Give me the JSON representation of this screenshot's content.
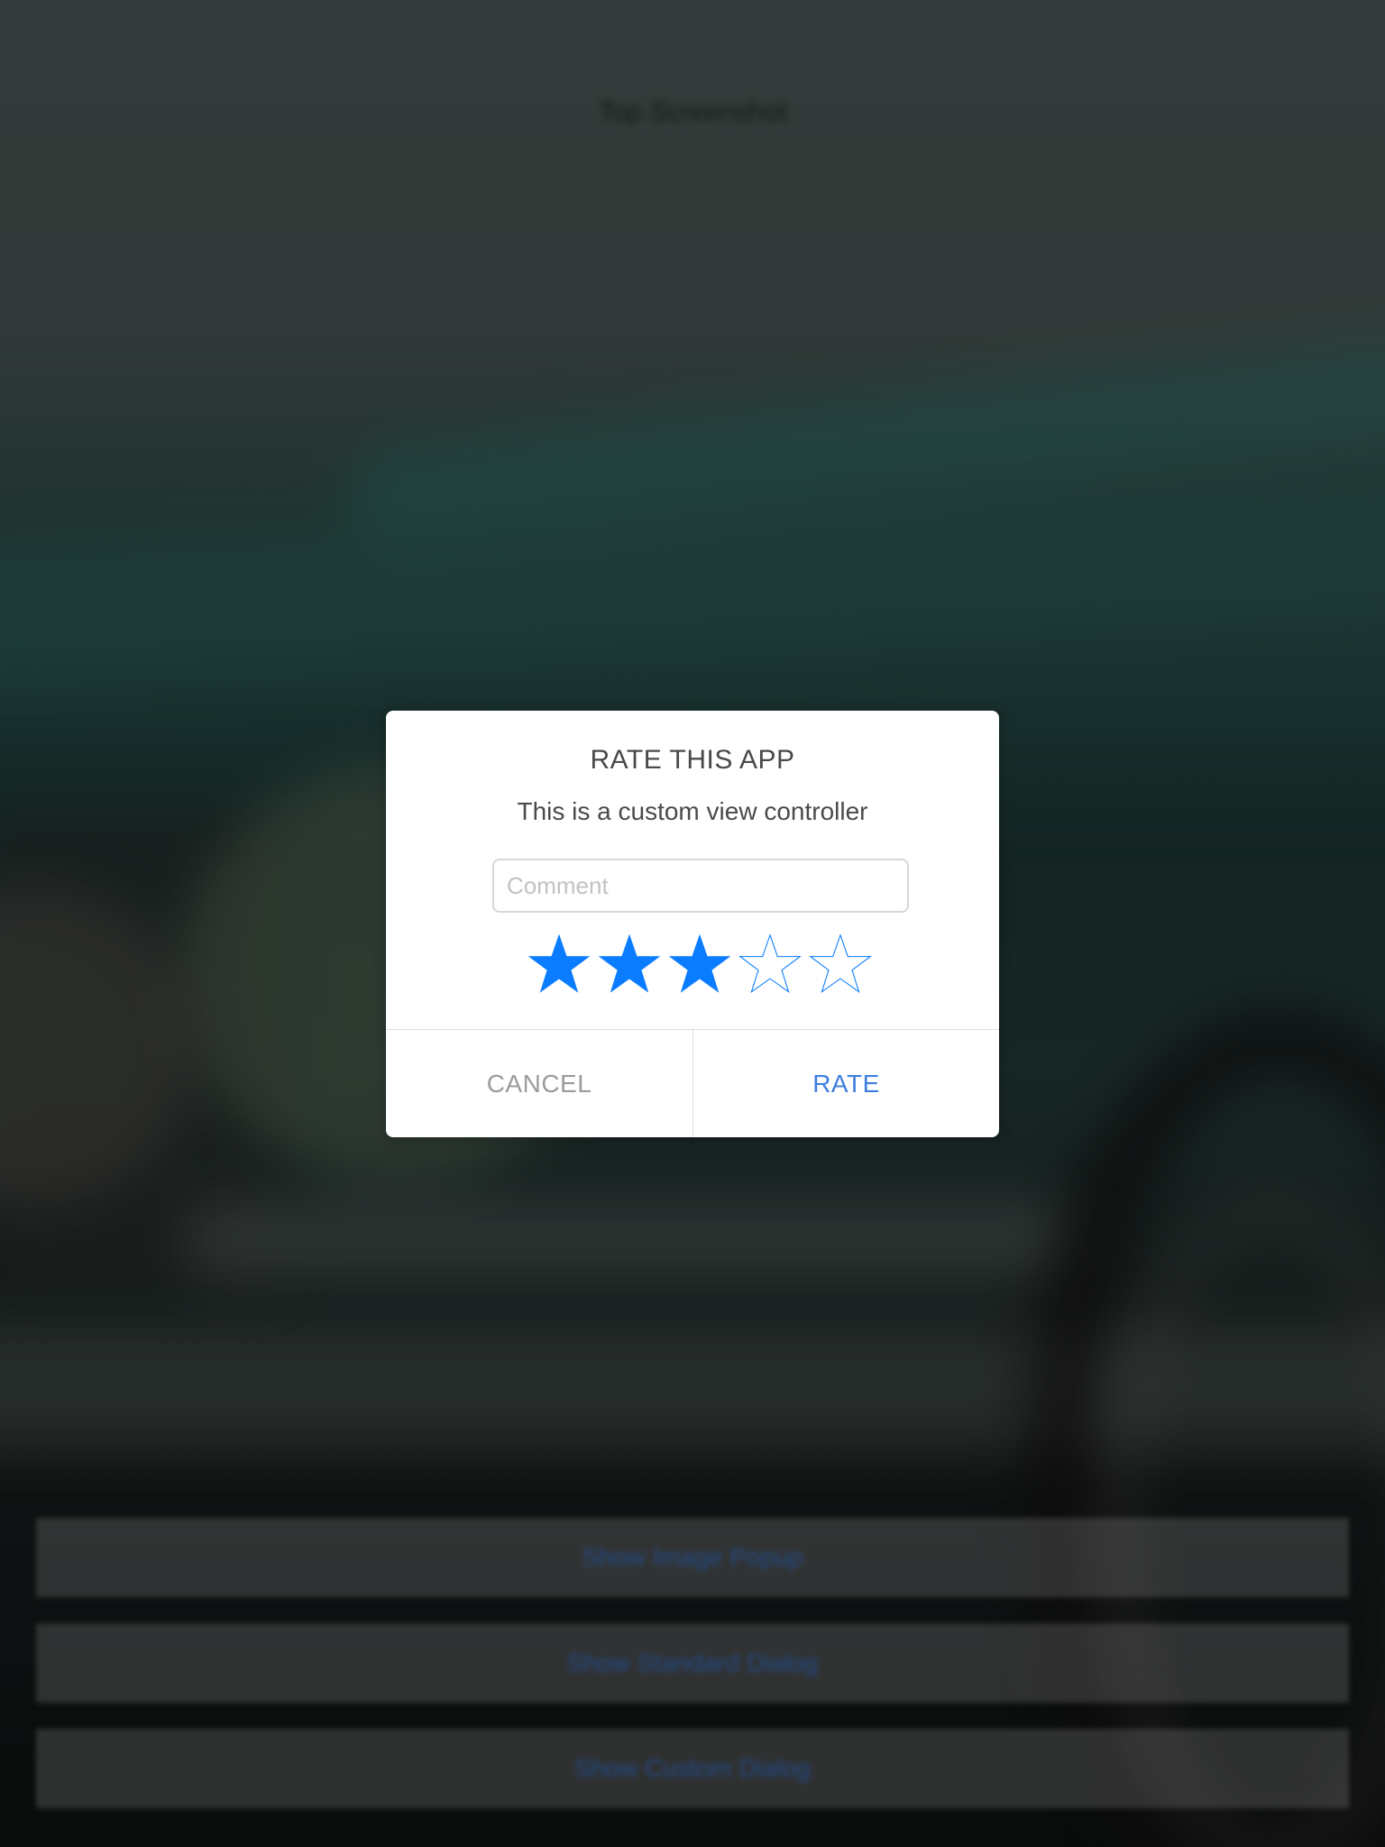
{
  "background": {
    "header_title": "Top Screenshot",
    "buttons": [
      {
        "label": "Show Image Popup"
      },
      {
        "label": "Show Standard Dialog"
      },
      {
        "label": "Show Custom Dialog"
      }
    ]
  },
  "dialog": {
    "title": "RATE THIS APP",
    "message": "This is a custom view controller",
    "comment": {
      "value": "",
      "placeholder": "Comment"
    },
    "rating": {
      "value": 3,
      "max": 5
    },
    "cancel_label": "CANCEL",
    "rate_label": "RATE"
  },
  "colors": {
    "accent": "#0a7cff",
    "rate_button": "#3d7fe0",
    "cancel_button": "#9b9b9b",
    "title_text": "#4a4a4a"
  }
}
